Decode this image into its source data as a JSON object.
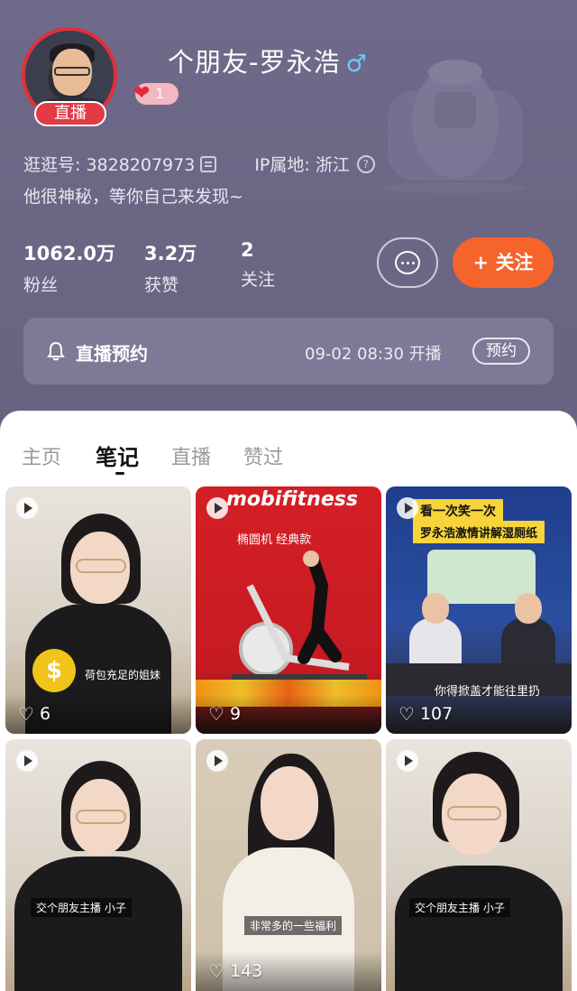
{
  "profile": {
    "username": "个朋友-罗永浩",
    "gender_icon": "♂",
    "live_badge": "直播",
    "like_badge_count": "1",
    "id_text": "逛逛号: 3828207973",
    "ip_text": "IP属地: 浙江",
    "bio": "他很神秘，等你自己来发现~"
  },
  "stats": [
    {
      "value": "1062.0万",
      "label": "粉丝"
    },
    {
      "value": "3.2万",
      "label": "获赞"
    },
    {
      "value": "2",
      "label": "关注"
    }
  ],
  "actions": {
    "follow_label": "+ 关注"
  },
  "live_reservation": {
    "title": "直播预约",
    "time": "09-02 08:30 开播",
    "button": "预约"
  },
  "tabs": [
    "主页",
    "笔记",
    "直播",
    "赞过"
  ],
  "active_tab": "笔记",
  "posts": [
    {
      "likes": "6",
      "caption": "荷包充足的姐妹",
      "coin_text": "$"
    },
    {
      "likes": "9",
      "brand": "mobifitness",
      "caption": "椭圆机 经典款"
    },
    {
      "likes": "107",
      "headline_1": "看一次笑一次",
      "headline_2": "罗永浩激情讲解湿厕纸",
      "caption": "你得掀盖才能往里扔"
    },
    {
      "likes": "",
      "caption": "交个朋友主播 小子"
    },
    {
      "likes": "143",
      "caption": "非常多的一些福利"
    },
    {
      "likes": "",
      "caption": "交个朋友主播 小子"
    }
  ],
  "colors": {
    "header_bg": "#6a6684",
    "accent_orange": "#f4642b",
    "live_red": "#e33a45",
    "gender_blue": "#6ec8ff"
  }
}
